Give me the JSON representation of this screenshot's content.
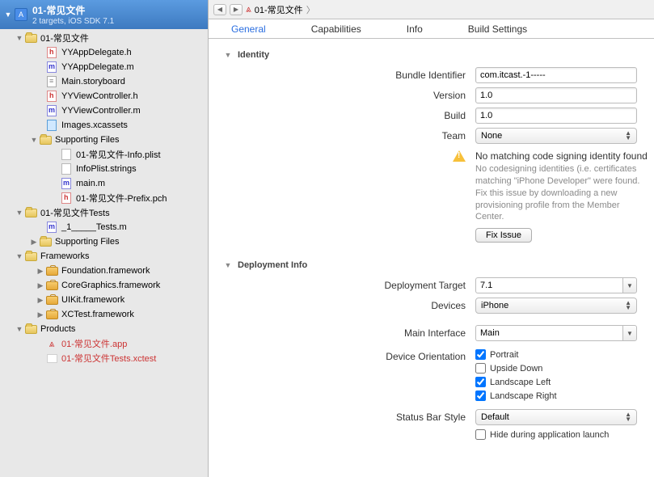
{
  "project": {
    "name": "01-常见文件",
    "subtitle": "2 targets, iOS SDK 7.1"
  },
  "tree": {
    "group1": "01-常见文件",
    "appDelegateH": "YYAppDelegate.h",
    "appDelegateM": "YYAppDelegate.m",
    "mainStoryboard": "Main.storyboard",
    "viewControllerH": "YYViewController.h",
    "viewControllerM": "YYViewController.m",
    "imagesXcassets": "Images.xcassets",
    "supportingFiles": "Supporting Files",
    "infoPlist": "01-常见文件-Info.plist",
    "infoPlistStrings": "InfoPlist.strings",
    "mainM": "main.m",
    "prefixPch": "01-常见文件-Prefix.pch",
    "testsGroup": "01-常见文件Tests",
    "testsM": "_1_____Tests.m",
    "supportingFiles2": "Supporting Files",
    "frameworks": "Frameworks",
    "foundation": "Foundation.framework",
    "coreGraphics": "CoreGraphics.framework",
    "uikit": "UIKit.framework",
    "xctest": "XCTest.framework",
    "products": "Products",
    "appProduct": "01-常见文件.app",
    "xctestProduct": "01-常见文件Tests.xctest"
  },
  "breadcrumb": "01-常见文件",
  "tabs": {
    "general": "General",
    "capabilities": "Capabilities",
    "info": "Info",
    "buildSettings": "Build Settings"
  },
  "sections": {
    "identity": "Identity",
    "deploymentInfo": "Deployment Info"
  },
  "identity": {
    "bundleIdLabel": "Bundle Identifier",
    "bundleId": "com.itcast.-1-----",
    "versionLabel": "Version",
    "version": "1.0",
    "buildLabel": "Build",
    "build": "1.0",
    "teamLabel": "Team",
    "team": "None",
    "warnHead": "No matching code signing identity found",
    "warnBody": "No codesigning identities (i.e. certificates matching \"iPhone Developer\" were found. Fix this issue by downloading a new provisioning profile from the Member Center.",
    "fixIssue": "Fix Issue"
  },
  "deployment": {
    "targetLabel": "Deployment Target",
    "target": "7.1",
    "devicesLabel": "Devices",
    "devices": "iPhone",
    "mainInterfaceLabel": "Main Interface",
    "mainInterface": "Main",
    "orientationLabel": "Device Orientation",
    "portrait": "Portrait",
    "upsideDown": "Upside Down",
    "landscapeLeft": "Landscape Left",
    "landscapeRight": "Landscape Right",
    "statusBarLabel": "Status Bar Style",
    "statusBar": "Default",
    "hideLaunch": "Hide during application launch"
  }
}
